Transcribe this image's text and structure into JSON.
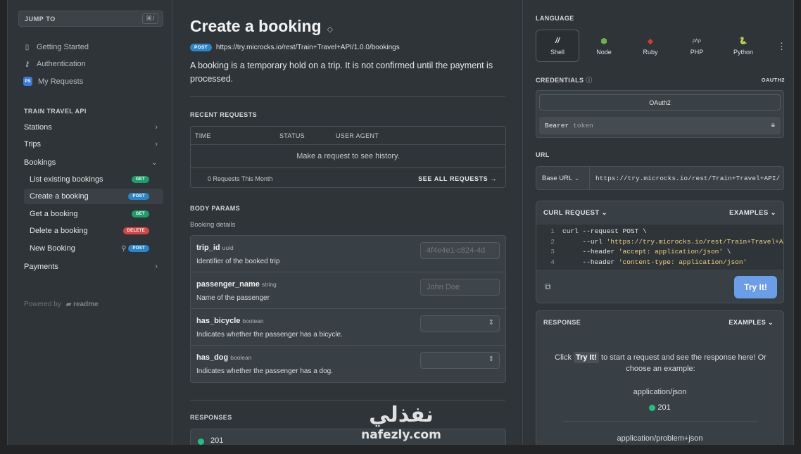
{
  "sidebar": {
    "jump_to": "JUMP TO",
    "jump_kbd": "⌘/",
    "top_nav": [
      {
        "label": "Getting Started",
        "icon": "book-icon"
      },
      {
        "label": "Authentication",
        "icon": "key-icon"
      },
      {
        "label": "My Requests",
        "icon": "ps-icon",
        "icon_text": "PS"
      }
    ],
    "section_title": "TRAIN TRAVEL API",
    "items": [
      {
        "label": "Stations",
        "chevron": "›"
      },
      {
        "label": "Trips",
        "chevron": "›"
      },
      {
        "label": "Bookings",
        "chevron": "⌄"
      }
    ],
    "sub_items": [
      {
        "label": "List existing bookings",
        "method": "GET"
      },
      {
        "label": "Create a booking",
        "method": "POST",
        "active": true
      },
      {
        "label": "Get a booking",
        "method": "GET"
      },
      {
        "label": "Delete a booking",
        "method": "DELETE"
      },
      {
        "label": "New Booking",
        "method": "POST",
        "webhook": true
      }
    ],
    "payments": {
      "label": "Payments",
      "chevron": "›"
    },
    "powered_by": "Powered by",
    "readme": "readme"
  },
  "main": {
    "title": "Create a booking",
    "method": "POST",
    "url": "https://try.microcks.io/rest/Train+Travel+API/1.0.0/bookings",
    "description": "A booking is a temporary hold on a trip. It is not confirmed until the payment is processed.",
    "recent_requests": {
      "heading": "RECENT REQUESTS",
      "columns": [
        "TIME",
        "STATUS",
        "USER AGENT"
      ],
      "empty": "Make a request to see history.",
      "count": "0 Requests This Month",
      "see_all": "SEE ALL REQUESTS"
    },
    "body_params": {
      "heading": "BODY PARAMS",
      "subtitle": "Booking details",
      "params": [
        {
          "name": "trip_id",
          "type": "uuid",
          "description": "Identifier of the booked trip",
          "placeholder": "4f4e4e1-c824-4d"
        },
        {
          "name": "passenger_name",
          "type": "string",
          "description": "Name of the passenger",
          "placeholder": "John Doe"
        },
        {
          "name": "has_bicycle",
          "type": "boolean",
          "description": "Indicates whether the passenger has a bicycle."
        },
        {
          "name": "has_dog",
          "type": "boolean",
          "description": "Indicates whether the passenger has a dog."
        }
      ]
    },
    "responses": {
      "heading": "RESPONSES",
      "first_code": "201"
    }
  },
  "right": {
    "language_label": "LANGUAGE",
    "languages": [
      {
        "label": "Shell",
        "icon": "//",
        "selected": true
      },
      {
        "label": "Node",
        "icon": "⬢"
      },
      {
        "label": "Ruby",
        "icon": "◆"
      },
      {
        "label": "PHP",
        "icon": "php"
      },
      {
        "label": "Python",
        "icon": "🐍"
      }
    ],
    "credentials_label": "CREDENTIALS",
    "credentials_type": "OAUTH2",
    "oauth_button": "OAuth2",
    "bearer_label": "Bearer",
    "bearer_placeholder": "token",
    "url_label": "URL",
    "base_url_label": "Base URL",
    "url_value": "https://try.microcks.io/rest/Train+Travel+API/",
    "curl_label": "CURL REQUEST",
    "examples_label": "EXAMPLES",
    "code_lines": [
      {
        "n": "1",
        "pre": "curl --request POST \\",
        "str": "",
        "post": ""
      },
      {
        "n": "2",
        "pre": "     --url ",
        "str": "'https://try.microcks.io/rest/Train+Travel+A",
        "post": ""
      },
      {
        "n": "3",
        "pre": "     --header ",
        "str": "'accept: application/json'",
        "post": " \\"
      },
      {
        "n": "4",
        "pre": "     --header ",
        "str": "'content-type: application/json'",
        "post": ""
      }
    ],
    "try_button": "Try It!",
    "response_label": "RESPONSE",
    "response_examples": "EXAMPLES",
    "response_msg_pre": "Click",
    "response_msg_kbd": "Try It!",
    "response_msg_post": "to start a request and see the response here! Or choose an example:",
    "example_type_1": "application/json",
    "example_code": "201",
    "example_type_2": "application/problem+json"
  },
  "watermark": {
    "arabic": "نفذلي",
    "latin": "nafezly.com"
  },
  "colors": {
    "get": "#1f9d6a",
    "post": "#2a86c9",
    "delete": "#d94545",
    "try": "#6a9ee8",
    "success_dot": "#21c07e"
  }
}
